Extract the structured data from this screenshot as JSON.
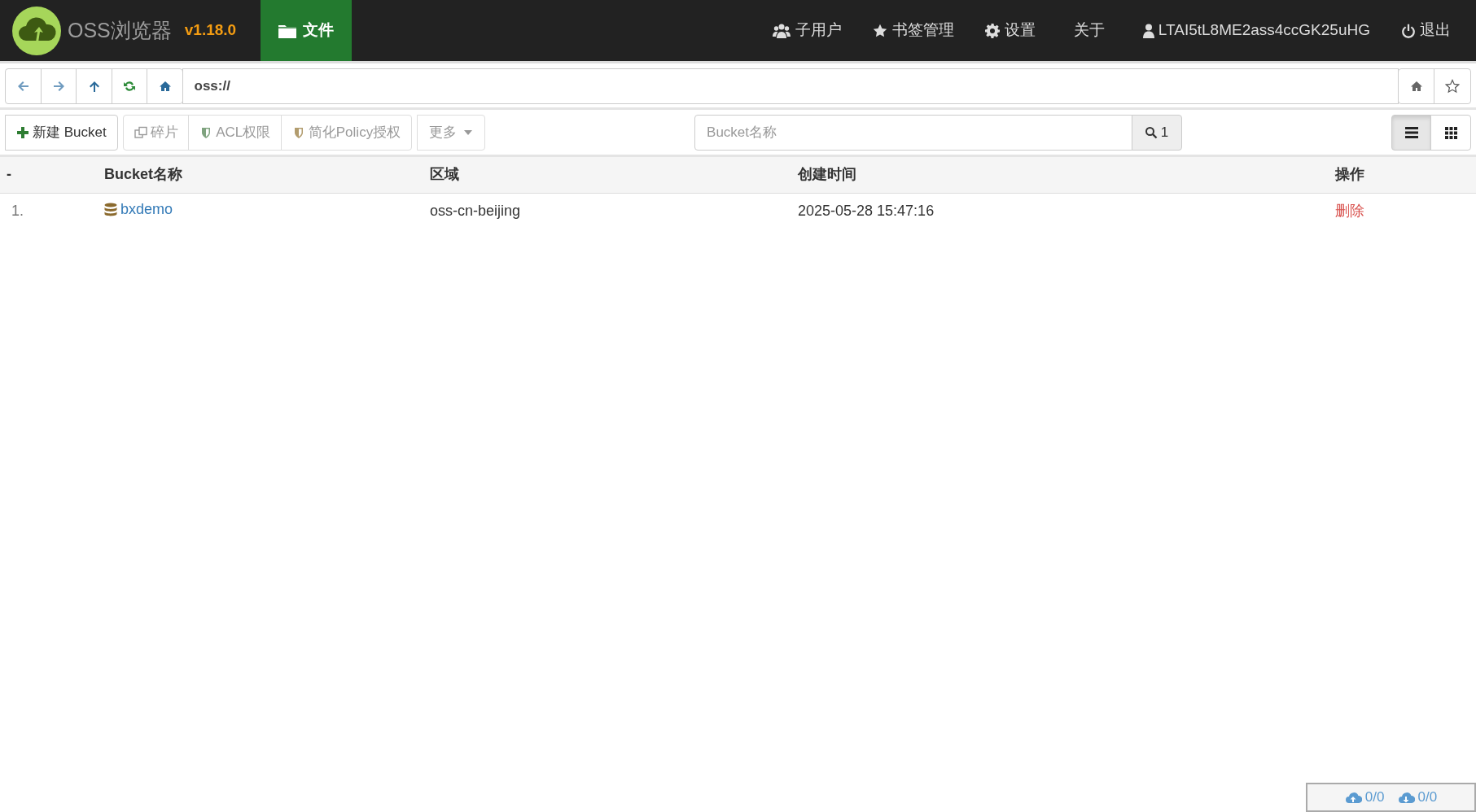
{
  "navbar": {
    "app_title": "OSS浏览器",
    "version": "v1.18.0",
    "tabs": [
      {
        "label": "文件",
        "selected": true
      }
    ],
    "menu": [
      {
        "label": "子用户",
        "kind": "users"
      },
      {
        "label": "书签管理",
        "kind": "star"
      },
      {
        "label": "设置",
        "kind": "gear"
      },
      {
        "label": "关于",
        "kind": "plain"
      },
      {
        "label": "LTAI5tL8ME2ass4ccGK25uHG",
        "kind": "user"
      },
      {
        "label": "退出",
        "kind": "power"
      }
    ]
  },
  "address_bar": {
    "value": "oss://"
  },
  "toolbar": {
    "buttons": [
      {
        "label": "新建 Bucket",
        "kind": "plus",
        "disabled": false
      },
      {
        "label": "碎片",
        "kind": "copy",
        "disabled": true
      },
      {
        "label": "ACL权限",
        "kind": "shield-green",
        "disabled": true
      },
      {
        "label": "简化Policy授权",
        "kind": "shield-tan",
        "disabled": true
      },
      {
        "label": "更多",
        "kind": "dropdown",
        "disabled": true
      }
    ],
    "search": {
      "placeholder": "Bucket名称",
      "button_label": "1"
    },
    "view_modes": [
      {
        "kind": "list",
        "selected": true
      },
      {
        "kind": "grid",
        "selected": false
      }
    ]
  },
  "table": {
    "columns": [
      "-",
      "Bucket名称",
      "区域",
      "创建时间",
      "操作"
    ],
    "rows": [
      {
        "index": "1.",
        "name": "bxdemo",
        "region": "oss-cn-beijing",
        "created": "2025-05-28 15:47:16",
        "action": "删除"
      }
    ]
  },
  "status_bar": {
    "upload": "0/0",
    "download": "0/0"
  }
}
